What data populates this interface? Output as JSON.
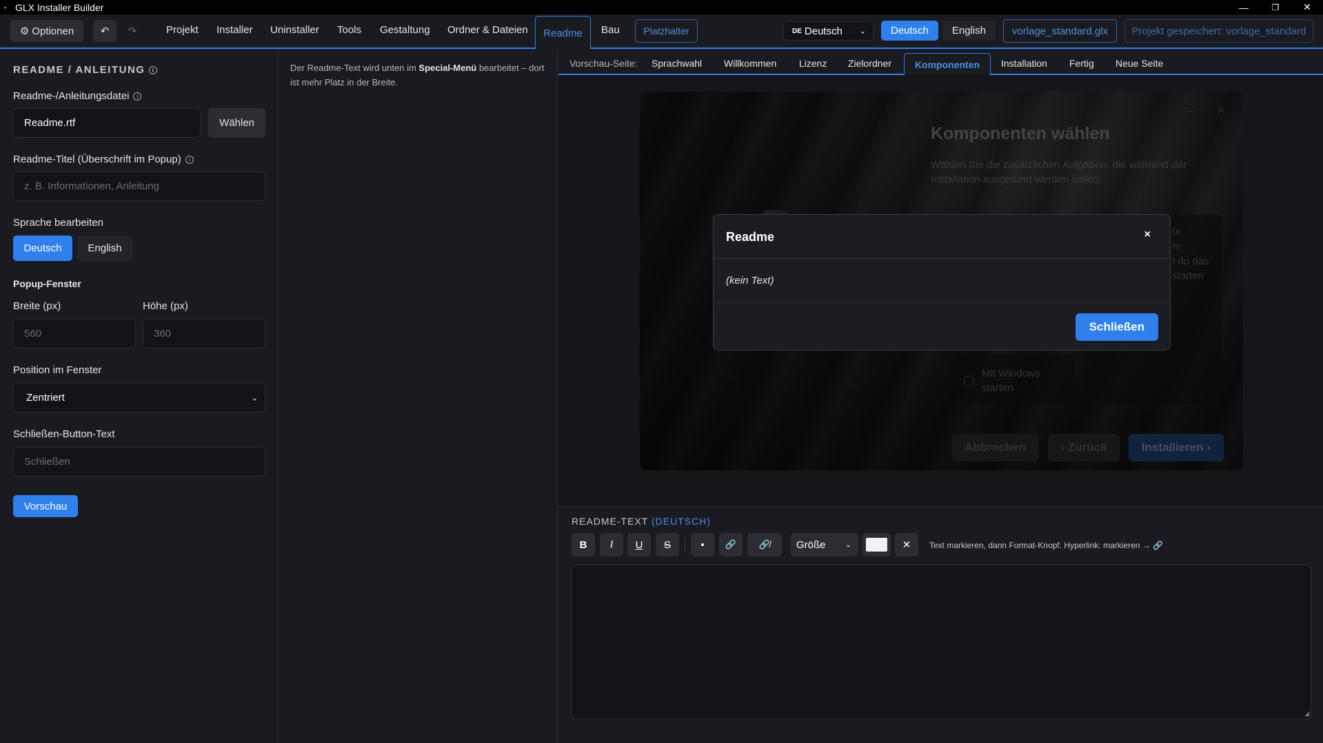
{
  "titlebar": {
    "icon": "app-icon",
    "title": "GLX Installer Builder",
    "min_glyph": "—",
    "max_glyph": "❐",
    "close_glyph": "✕"
  },
  "toolbar": {
    "options_label": "Optionen",
    "undo_glyph": "↶",
    "redo_glyph": "↷",
    "tabs": [
      "Projekt",
      "Installer",
      "Uninstaller",
      "Tools",
      "Gestaltung",
      "Ordner & Dateien",
      "Readme",
      "Bau"
    ],
    "active_tab": "Readme",
    "placeholder_button": "Platzhalter",
    "language_select": {
      "flag": "DE",
      "value": "Deutsch"
    },
    "lang_buttons": [
      "Deutsch",
      "English"
    ],
    "template_file": "vorlage_standard.glx",
    "saved_status": "Projekt gespeichert: vorlage_standard"
  },
  "left": {
    "section_title": "README / ANLEITUNG",
    "file_label": "Readme-/Anleitungsdatei",
    "file_value": "Readme.rtf",
    "choose_button": "Wählen",
    "title_label": "Readme-Titel (Überschrift im Popup)",
    "title_placeholder": "z. B. Informationen, Anleitung",
    "edit_lang_label": "Sprache bearbeiten",
    "edit_lang_buttons": [
      "Deutsch",
      "English"
    ],
    "popup_heading": "Popup-Fenster",
    "width_label": "Breite (px)",
    "width_placeholder": "560",
    "height_label": "Höhe (px)",
    "height_placeholder": "360",
    "position_label": "Position im Fenster",
    "position_value": "Zentriert",
    "close_text_label": "Schließen-Button-Text",
    "close_text_placeholder": "Schließen",
    "preview_button": "Vorschau"
  },
  "middle": {
    "note_pre": "Der Readme-Text wird unten im ",
    "note_bold": "Special-Menü",
    "note_post": " bearbeitet – dort ist mehr Platz in der Breite."
  },
  "preview": {
    "label": "Vorschau-Seite:",
    "tabs": [
      "Sprachwahl",
      "Willkommen",
      "Lizenz",
      "Zielordner",
      "Komponenten",
      "Installation",
      "Fertig",
      "Neue Seite"
    ],
    "active_tab": "Komponenten",
    "window": {
      "title": "Komponenten wählen",
      "subtitle": "Wählen Sie die zusätzlichen Aufgaben, die während der Installation ausgeführt werden sollen.",
      "win_min": "—",
      "win_close": "✕",
      "side_text": [
        "ür",
        "m",
        "t du das",
        "starten"
      ],
      "checkbox_label": "Mit Windows starten",
      "buttons": [
        "Abbrechen",
        "‹ Zurück",
        "Installieren ›"
      ]
    },
    "modal": {
      "title": "Readme",
      "close_glyph": "×",
      "body": "(kein Text)",
      "button": "Schließen"
    }
  },
  "editor": {
    "label": "README-TEXT",
    "label_lang": "(DEUTSCH)",
    "buttons": [
      "B",
      "I",
      "U",
      "S",
      "•",
      "🔗",
      "🔗̸"
    ],
    "size_select": "Größe",
    "clear_glyph": "✕",
    "hint": "Text markieren, dann Format-Knopf. Hyperlink: markieren → 🔗"
  }
}
